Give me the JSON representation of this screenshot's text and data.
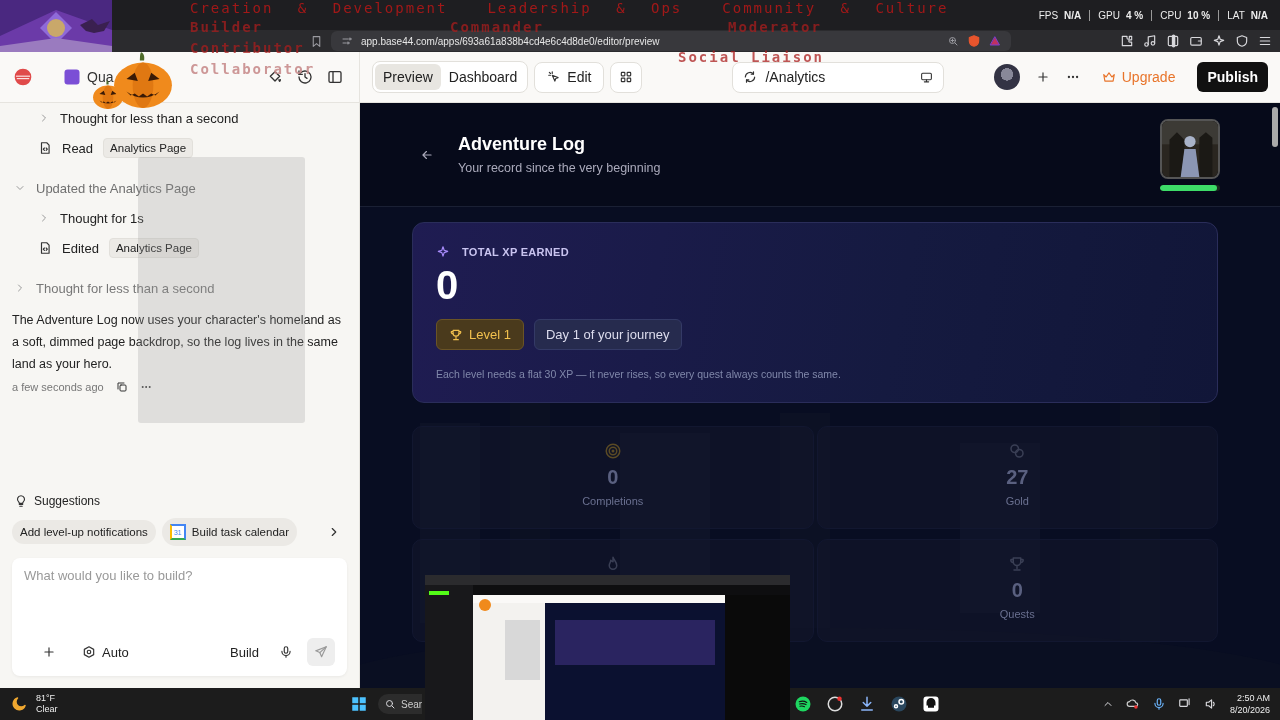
{
  "stream_overlay": {
    "columns": [
      {
        "category": "Creation & Development",
        "roles": [
          "Builder",
          "Contributor",
          "Collaborator"
        ]
      },
      {
        "category": "Leadership & Ops",
        "roles": [
          "Commander"
        ]
      },
      {
        "category": "Community & Culture",
        "roles": [
          "Moderator",
          "Social Liaison"
        ]
      }
    ]
  },
  "system_stats": [
    {
      "label": "FPS",
      "value": "N/A"
    },
    {
      "label": "GPU",
      "value": "4 %"
    },
    {
      "label": "CPU",
      "value": "10 %"
    },
    {
      "label": "LAT",
      "value": "N/A"
    }
  ],
  "browser": {
    "url": "app.base44.com/apps/693a61a838b4cd4e6c4d8de0/editor/preview"
  },
  "toolbar": {
    "project_name": "Qua",
    "view_tabs": [
      {
        "label": "Preview",
        "selected": true
      },
      {
        "label": "Dashboard",
        "selected": false
      }
    ],
    "edit_button": "Edit",
    "route": "/Analytics",
    "upgrade": "Upgrade",
    "publish": "Publish"
  },
  "chat": {
    "earlier_steps": [
      {
        "kind": "thought",
        "text": "Thought for less than a second",
        "expanded": false
      },
      {
        "kind": "file",
        "action": "Read",
        "file": "Analytics Page"
      }
    ],
    "items": [
      {
        "kind": "group",
        "text": "Updated the Analytics Page",
        "expanded": true,
        "children": [
          {
            "kind": "thought",
            "text": "Thought for 1s",
            "expanded": false
          },
          {
            "kind": "file",
            "action": "Edited",
            "file": "Analytics Page"
          }
        ]
      },
      {
        "kind": "thought",
        "text": "Thought for less than a second",
        "expanded": false
      }
    ],
    "message": "The Adventure Log now uses your character's homeland as a soft, dimmed page backdrop, so the log lives in the same land as your hero.",
    "timestamp": "a few seconds ago",
    "suggestions_title": "Suggestions",
    "suggestions": [
      {
        "text": "Add level-up notifications",
        "kind": "plain"
      },
      {
        "text": "Build task calendar",
        "kind": "calendar",
        "badge": "31"
      }
    ],
    "composer": {
      "placeholder": "What would you like to build?",
      "mode": "Auto",
      "build": "Build"
    }
  },
  "preview": {
    "title": "Adventure Log",
    "subtitle": "Your record since the very beginning",
    "health": {
      "level": 0.95
    },
    "xp_label": "TOTAL XP EARNED",
    "xp_value": "0",
    "level_badge": "Level 1",
    "day_badge": "Day 1 of your journey",
    "note": "Each level needs a flat 30 XP — it never rises, so every quest always counts the same.",
    "stats": [
      {
        "kind": "target",
        "value": "0",
        "label": "Completions"
      },
      {
        "kind": "coins",
        "value": "27",
        "label": "Gold"
      },
      {
        "kind": "flame"
      },
      {
        "kind": "trophy",
        "value": "0",
        "label": "Quests"
      }
    ]
  },
  "taskbar": {
    "temperature": "81°F",
    "weather": "Clear",
    "search": "Sear",
    "time": "2:50 AM",
    "date": "8/20/2026"
  }
}
